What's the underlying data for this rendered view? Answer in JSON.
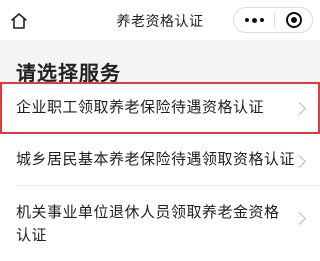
{
  "header": {
    "title": "养老资格认证",
    "home_icon": "home-icon",
    "more_icon": "more-dots-icon",
    "close_icon": "close-miniapp-icon"
  },
  "section": {
    "title": "请选择服务"
  },
  "services": [
    {
      "label": "企业职工领取养老保险待遇资格认证",
      "highlighted": true
    },
    {
      "label": "城乡居民基本养老保险待遇领取资格认证",
      "highlighted": false
    },
    {
      "label": "机关事业单位退休人员领取养老金资格认证",
      "highlighted": false
    }
  ],
  "colors": {
    "highlight_border": "#e23a3a",
    "background": "#f5f5f5",
    "chevron": "#b8b8b8"
  }
}
